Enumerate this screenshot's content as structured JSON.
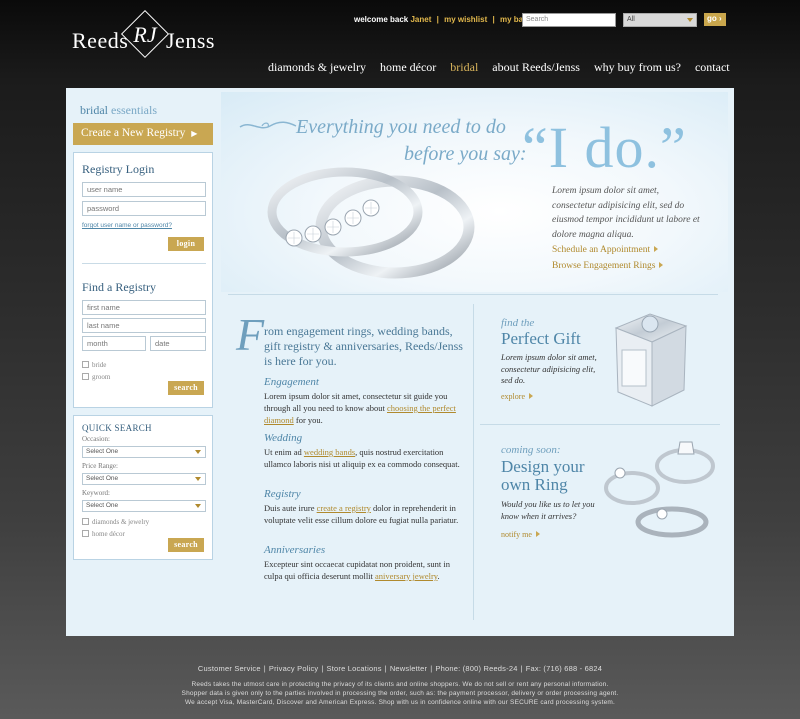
{
  "header": {
    "logo_left": "Reeds",
    "logo_mono": "RJ",
    "logo_right": "Jenss",
    "welcome_prefix": "welcome back",
    "user_name": "Janet",
    "wishlist": "my wishlist",
    "bag": "my bag",
    "search_placeholder": "Search",
    "select_value": "All",
    "go_label": "go"
  },
  "nav": [
    "diamonds & jewelry",
    "home décor",
    "bridal",
    "about Reeds/Jenss",
    "why buy from us?",
    "contact"
  ],
  "sidebar": {
    "title_a": "bridal",
    "title_b": "essentials",
    "create_registry": "Create a New Registry",
    "login": {
      "title": "Registry Login",
      "username_placeholder": "user name",
      "password_placeholder": "password",
      "forgot": "forgot user name or password?",
      "button": "login"
    },
    "find": {
      "title": "Find a Registry",
      "first_placeholder": "first name",
      "last_placeholder": "last name",
      "month_placeholder": "month",
      "date_placeholder": "date",
      "bride": "bride",
      "groom": "groom",
      "button": "search"
    },
    "quick": {
      "title": "QUICK SEARCH",
      "occasion_label": "Occasion:",
      "occasion_value": "Select One",
      "price_label": "Price Range:",
      "price_value": "Select One",
      "keyword_label": "Keyword:",
      "keyword_value": "Select One",
      "opt1": "diamonds & jewelry",
      "opt2": "home décor",
      "button": "search"
    }
  },
  "hero": {
    "line1": "Everything you need to do",
    "line2": "before you say:",
    "ido": "“I do.”",
    "body": "Lorem ipsum dolor sit amet, consectetur adipisicing elit, sed do eiusmod tempor incididunt ut labore et dolore magna aliqua.",
    "link1": "Schedule an Appointment",
    "link2": "Browse Engagement Rings"
  },
  "middle": {
    "drop": "F",
    "intro": "rom engagement rings, wedding bands, gift registry & anniversaries, Reeds/Jenss is here for you.",
    "sections": [
      {
        "heading": "Engagement",
        "pre": "Lorem ipsum dolor sit amet, consectetur sit guide you through all you need to know about ",
        "link": "choosing the perfect diamond",
        "post": " for you."
      },
      {
        "heading": "Wedding",
        "pre": "Ut enim ad ",
        "link": "wedding bands",
        "post": ", quis nostrud exercitation ullamco laboris nisi ut aliquip ex ea commodo consequat."
      },
      {
        "heading": "Registry",
        "pre": "Duis aute irure ",
        "link": "create a registry",
        "post": " dolor in reprehenderit in voluptate velit esse cillum dolore eu fugiat nulla pariatur."
      },
      {
        "heading": "Anniversaries",
        "pre": "Excepteur sint occaecat cupidatat non proident, sunt in culpa qui officia deserunt mollit ",
        "link": "aniversary jewelry",
        "post": "."
      }
    ]
  },
  "right": {
    "gift_small": "find the",
    "gift_big": "Perfect Gift",
    "gift_body": "Lorem ipsum dolor sit amet, consectetur adipisicing elit, sed do.",
    "gift_link": "explore",
    "ring_small": "coming soon:",
    "ring_big1": "Design your",
    "ring_big2": "own Ring",
    "ring_body": "Would you like us to let you know when it arrives?",
    "ring_link": "notify me"
  },
  "footer": {
    "links": [
      "Customer Service",
      "Privacy Policy",
      "Store Locations",
      "Newsletter",
      "Phone: (800) Reeds-24",
      "Fax: (716) 688 - 6824"
    ],
    "line1": "Reeds takes the utmost care in protecting the privacy of its clients and online shoppers. We do not sell or rent any personal information.",
    "line2": "Shopper data is given only to the parties involved in processing the order, such as: the payment processor, delivery or order processing agent.",
    "line3": "We accept Visa, MasterCard, Discover and American Express.  Shop with us in confidence online with our SECURE card processing system."
  }
}
